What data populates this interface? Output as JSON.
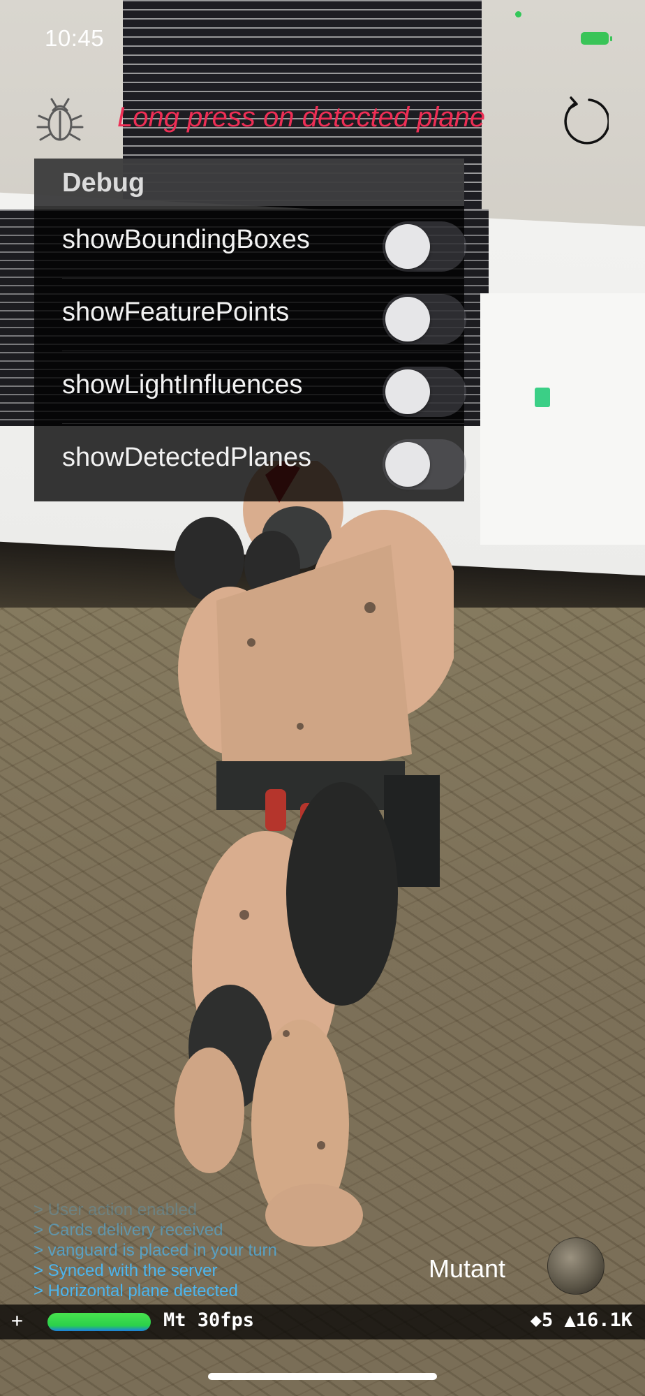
{
  "status_bar": {
    "time": "10:45"
  },
  "top_bar": {
    "hint": "Long press on detected plane",
    "bug_icon": "bug-icon",
    "reset_icon": "reload-icon"
  },
  "debug_panel": {
    "title": "Debug",
    "options": [
      {
        "label": "showBoundingBoxes",
        "enabled": false
      },
      {
        "label": "showFeaturePoints",
        "enabled": false
      },
      {
        "label": "showLightInfluences",
        "enabled": false
      },
      {
        "label": "showDetectedPlanes",
        "enabled": false
      }
    ]
  },
  "console_log": [
    "> User action enabled",
    "> Cards delivery received",
    "> vanguard is placed in your turn",
    "> Synced with the server",
    "> Horizontal plane detected"
  ],
  "mode_label": "Mutant",
  "stats_bar": {
    "plus": "+",
    "fps_text": "Mt 30fps",
    "nodes_text": "◆5 ▲16.1K"
  },
  "colors": {
    "hint": "#ee2e55",
    "log": "#4cb5ee",
    "fps_meter": "#2bd14a"
  }
}
